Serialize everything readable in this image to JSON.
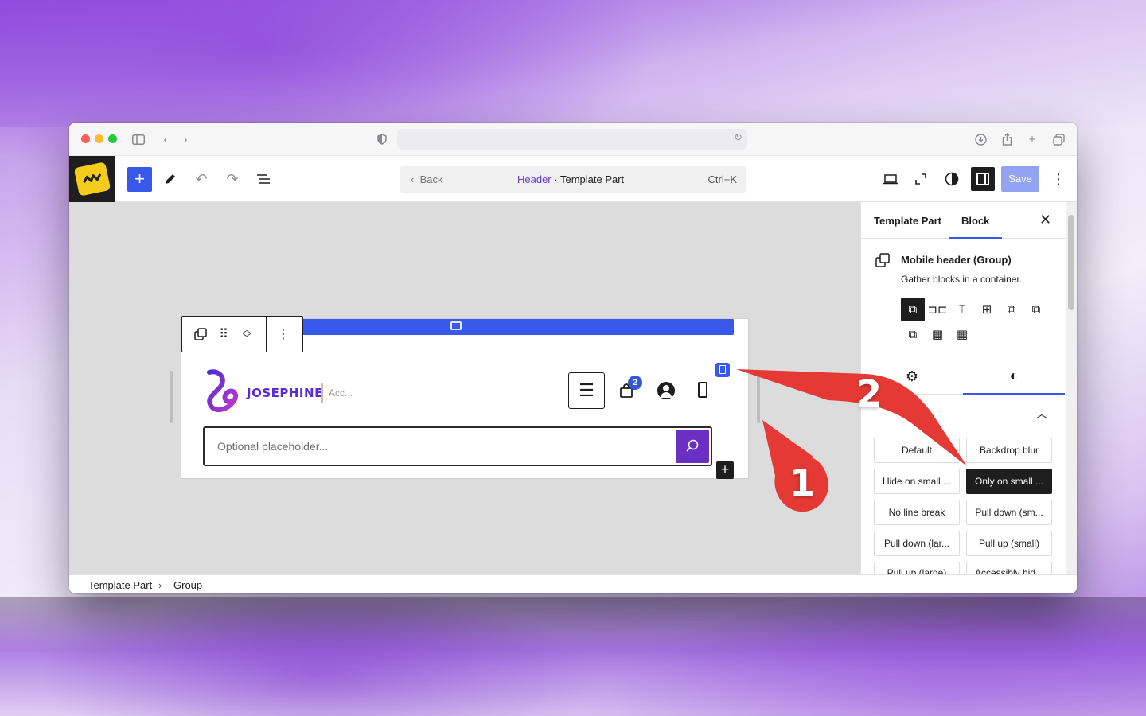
{
  "browser": {
    "url": ""
  },
  "editor": {
    "command_bar": {
      "back_label": "Back",
      "crumb_highlight": "Header",
      "crumb_rest": " · Template Part",
      "shortcut": "Ctrl+K"
    },
    "save_label": "Save"
  },
  "canvas": {
    "site_title": "JOSEPHINE",
    "tagline": "Acc...",
    "cart_count": "2",
    "search_placeholder": "Optional placeholder..."
  },
  "sidebar": {
    "tabs": [
      "Template Part",
      "Block"
    ],
    "active_tab": "Block",
    "block_title": "Mobile header (Group)",
    "block_description": "Gather blocks in a container.",
    "styles": [
      "Default",
      "Backdrop blur",
      "Hide on small ...",
      "Only on small ...",
      "No line break",
      "Pull down (sm...",
      "Pull down (lar...",
      "Pull up (small)",
      "Pull up (large)",
      "Accessibly hid..."
    ],
    "selected_style": "Only on small ..."
  },
  "footer": {
    "crumbs": [
      "Template Part",
      "Group"
    ]
  },
  "annotations": {
    "label_1": "1",
    "label_2": "2",
    "color": "#e53935"
  }
}
